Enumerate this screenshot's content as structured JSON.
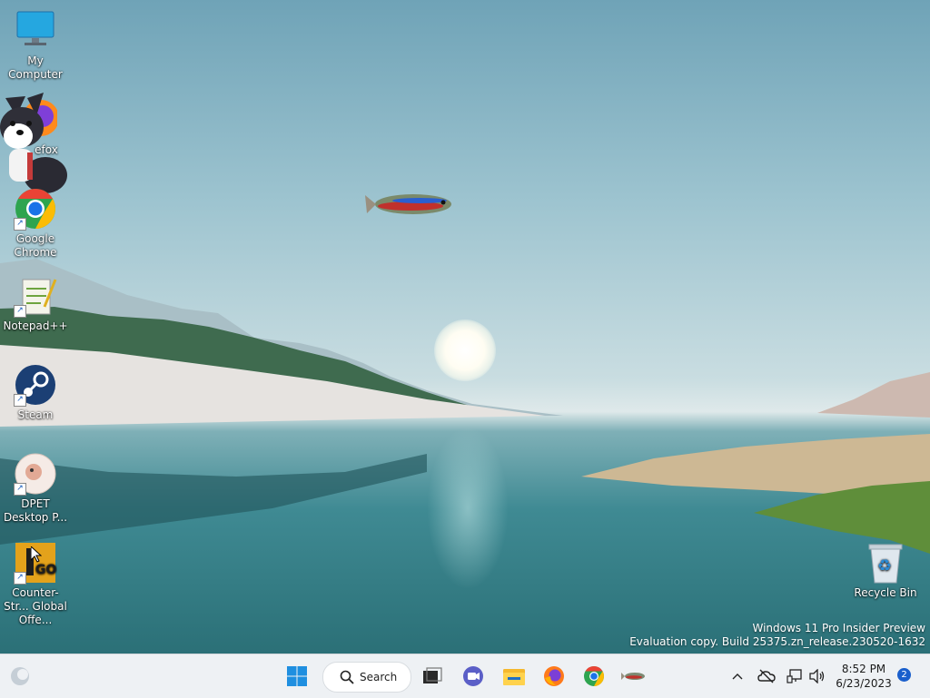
{
  "desktop": {
    "icons": [
      {
        "label": "My Computer",
        "icon": "monitor-icon"
      },
      {
        "label": "Firefox",
        "icon": "firefox-icon"
      },
      {
        "label": "Google Chrome",
        "icon": "chrome-icon"
      },
      {
        "label": "Notepad++",
        "icon": "notepadpp-icon"
      },
      {
        "label": "Steam",
        "icon": "steam-icon"
      },
      {
        "label": "DPET Desktop P...",
        "icon": "dpet-icon"
      },
      {
        "label": "Counter-Str... Global Offe...",
        "icon": "csgo-icon"
      },
      {
        "label": "Recycle Bin",
        "icon": "recycle-bin-icon"
      }
    ],
    "firefox_visible_label": "efox",
    "watermark_line1": "Windows 11 Pro Insider Preview",
    "watermark_line2": "Evaluation copy. Build 25375.zn_release.230520-1632"
  },
  "taskbar": {
    "search_label": "Search",
    "time": "8:52 PM",
    "date": "6/23/2023",
    "notification_count": "2",
    "apps": [
      "start-icon",
      "task-view-icon",
      "teams-meet-icon",
      "file-explorer-icon",
      "firefox-icon",
      "chrome-icon",
      "fish-app-icon"
    ],
    "tray": [
      "show-hidden-icons-chevron",
      "onedrive-offline-icon",
      "network-icon",
      "volume-icon"
    ]
  },
  "colors": {
    "accent": "#1a5fcc",
    "taskbar_bg": "#eef1f4"
  }
}
